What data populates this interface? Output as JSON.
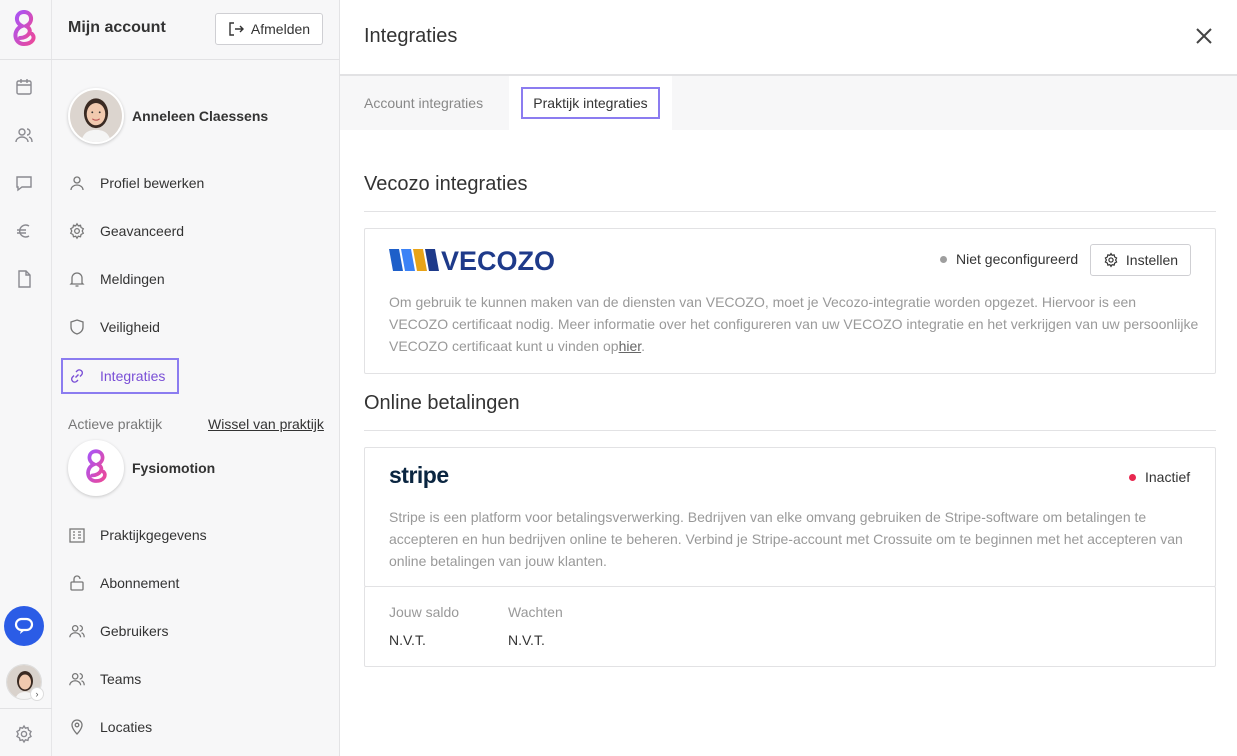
{
  "sidebar": {
    "title": "Mijn account",
    "logout_label": "Afmelden",
    "user_name": "Anneleen Claessens",
    "account_items": [
      {
        "label": "Profiel bewerken",
        "icon": "user-icon"
      },
      {
        "label": "Geavanceerd",
        "icon": "gear-icon"
      },
      {
        "label": "Meldingen",
        "icon": "bell-icon"
      },
      {
        "label": "Veiligheid",
        "icon": "shield-icon"
      },
      {
        "label": "Integraties",
        "icon": "link-icon",
        "active": true
      }
    ],
    "active_practice_label": "Actieve praktijk",
    "switch_practice_label": "Wissel van praktijk",
    "practice_name": "Fysiomotion",
    "practice_items": [
      {
        "label": "Praktijkgegevens",
        "icon": "building-icon"
      },
      {
        "label": "Abonnement",
        "icon": "lock-icon"
      },
      {
        "label": "Gebruikers",
        "icon": "users-icon"
      },
      {
        "label": "Teams",
        "icon": "users-icon"
      },
      {
        "label": "Locaties",
        "icon": "location-pin-icon"
      }
    ]
  },
  "main": {
    "title": "Integraties",
    "tabs": [
      {
        "label": "Account integraties",
        "active": false
      },
      {
        "label": "Praktijk integraties",
        "active": true
      }
    ],
    "vecozo": {
      "section_title": "Vecozo integraties",
      "logo_text": "VECOZO",
      "status": "Niet geconfigureerd",
      "status_color": "#9e9e9e",
      "button_label": "Instellen",
      "description": "Om gebruik te kunnen maken van de diensten van VECOZO, moet je Vecozo-integratie worden opgezet. Hiervoor is een VECOZO certificaat nodig. Meer informatie over het configureren van uw VECOZO integratie en het verkrijgen van uw persoonlijke VECOZO certificaat kunt u vinden op",
      "link_text": "hier",
      "description_end": "."
    },
    "payments": {
      "section_title": "Online betalingen",
      "logo_text": "stripe",
      "status": "Inactief",
      "status_color": "#e8274f",
      "description": "Stripe is een platform voor betalingsverwerking. Bedrijven van elke omvang gebruiken de Stripe-software om betalingen te accepteren en hun bedrijven online te beheren. Verbind je Stripe-account met Crossuite om te beginnen met het accepteren van online betalingen van jouw klanten.",
      "balance_label": "Jouw saldo",
      "balance_value": "N.V.T.",
      "pending_label": "Wachten",
      "pending_value": "N.V.T."
    }
  },
  "colors": {
    "accent": "#7a4fd6",
    "highlight_border": "#8b7cf0",
    "chat_button": "#2b5ce6",
    "vecozo_blue": "#1e3a8a",
    "stripe_navy": "#0a2540"
  }
}
